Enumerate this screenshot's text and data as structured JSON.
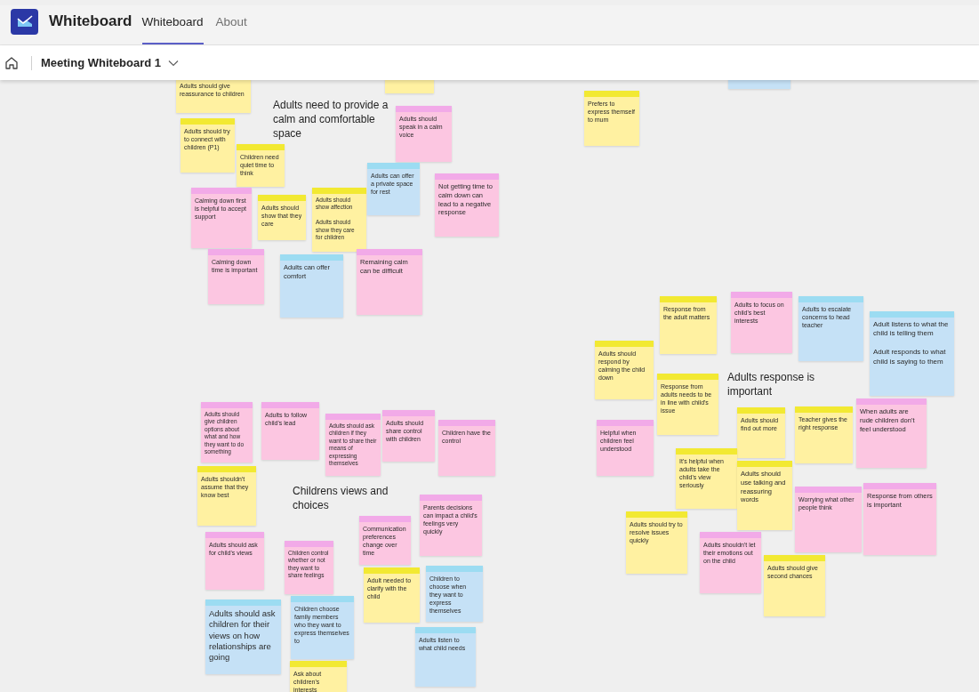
{
  "app": {
    "name": "Whiteboard"
  },
  "tabs": [
    {
      "label": "Whiteboard",
      "selected": true
    },
    {
      "label": "About",
      "selected": false
    }
  ],
  "breadcrumb": {
    "title": "Meeting Whiteboard 1"
  },
  "board": {
    "headings": [
      "Adults need to provide a calm and comfortable space",
      "Adults response is important",
      "Childrens views and choices"
    ],
    "notes": [
      {
        "text": "Adults should give reassurance to children",
        "color": "#fff1a1"
      },
      {
        "color": "#fff1a1"
      },
      {
        "color": "#c5e1f6"
      },
      {
        "text": "Prefers to express themself to mum",
        "color": "#fff1a1"
      },
      {
        "text": "Adults should speak in a calm voice",
        "color": "#fcc6e1"
      },
      {
        "text": "Adults should try to connect with children (P1)",
        "color": "#fff1a1"
      },
      {
        "text": "Children need quiet time to think",
        "color": "#fff1a1"
      },
      {
        "text": "Calming down first is helpful to accept support",
        "color": "#fcc6e1"
      },
      {
        "text": "Adults should show that they care",
        "color": "#fff1a1"
      },
      {
        "text": "Adults should show affection\n\nAdults should show they care for children",
        "color": "#fff1a1"
      },
      {
        "text": "Adults can offer a private space for rest",
        "color": "#c5e1f6"
      },
      {
        "text": "Not getting time to calm down can lead to a negative response",
        "color": "#fcc6e1"
      },
      {
        "text": "Calming down time is important",
        "color": "#fcc6e1"
      },
      {
        "text": "Adults can offer comfort",
        "color": "#c5e1f6"
      },
      {
        "text": "Remaining calm can be difficult",
        "color": "#fcc6e1"
      },
      {
        "text": "Response from the adult matters",
        "color": "#fff1a1"
      },
      {
        "text": "Adults to focus on child's best interests",
        "color": "#fcc6e1"
      },
      {
        "text": "Adults to escalate concerns to head teacher",
        "color": "#c5e1f6"
      },
      {
        "text": "Adult listens to what the child is telling them\n\nAdult responds to what child is saying to them",
        "color": "#c5e1f6"
      },
      {
        "text": "Adults should respond by calming the child down",
        "color": "#fff1a1"
      },
      {
        "text": "Response from adults needs to be in line with child's issue",
        "color": "#fff1a1"
      },
      {
        "text": "Adults should give children options about what and how they want to do something",
        "color": "#fcc6e1"
      },
      {
        "text": "Adults to follow child's lead",
        "color": "#fcc6e1"
      },
      {
        "text": "Adults should ask children if they want to share their means of expressing themselves",
        "color": "#fcc6e1"
      },
      {
        "text": "Adults should share control with children",
        "color": "#fcc6e1"
      },
      {
        "text": "Children have the control",
        "color": "#fcc6e1"
      },
      {
        "text": "Helpful when children feel understood",
        "color": "#fcc6e1"
      },
      {
        "text": "Adults should find out more",
        "color": "#fff1a1"
      },
      {
        "text": "Teacher gives the right response",
        "color": "#fff1a1"
      },
      {
        "text": "When adults are rude children don't feel understood",
        "color": "#fcc6e1"
      },
      {
        "text": "Adults shouldn't assume that they know best",
        "color": "#fff1a1"
      },
      {
        "text": "It's helpful when adults take the child's view seriously",
        "color": "#fff1a1"
      },
      {
        "text": "Adults should use talking and reassuring words",
        "color": "#fff1a1"
      },
      {
        "text": "Worrying what other people think",
        "color": "#fcc6e1"
      },
      {
        "text": "Response from others is important",
        "color": "#fcc6e1"
      },
      {
        "text": "Adults should ask for child's views",
        "color": "#fcc6e1"
      },
      {
        "text": "Children control whether or not they want to share feelings",
        "color": "#fcc6e1"
      },
      {
        "text": "Communication preferences change over time",
        "color": "#fcc6e1"
      },
      {
        "text": "Parents decisions can impact a child's feelings very quickly",
        "color": "#fcc6e1"
      },
      {
        "text": "Adults should try to resolve issues quickly",
        "color": "#fff1a1"
      },
      {
        "text": "Adults shouldn't let their emotions out on the child",
        "color": "#fcc6e1"
      },
      {
        "text": "Adults should give second chances",
        "color": "#fff1a1"
      },
      {
        "text": "Adult needed to clarify with the child",
        "color": "#fff1a1"
      },
      {
        "text": "Children to choose when they want to express themselves",
        "color": "#c5e1f6"
      },
      {
        "text": "Adults should ask children for their views on how relationships are going",
        "color": "#c5e1f6"
      },
      {
        "text": "Children choose family members who they want to express themselves to",
        "color": "#c5e1f6"
      },
      {
        "text": "Adults listen to what child needs",
        "color": "#c5e1f6"
      },
      {
        "text": "Ask about children's interests",
        "color": "#fff1a1"
      }
    ]
  }
}
